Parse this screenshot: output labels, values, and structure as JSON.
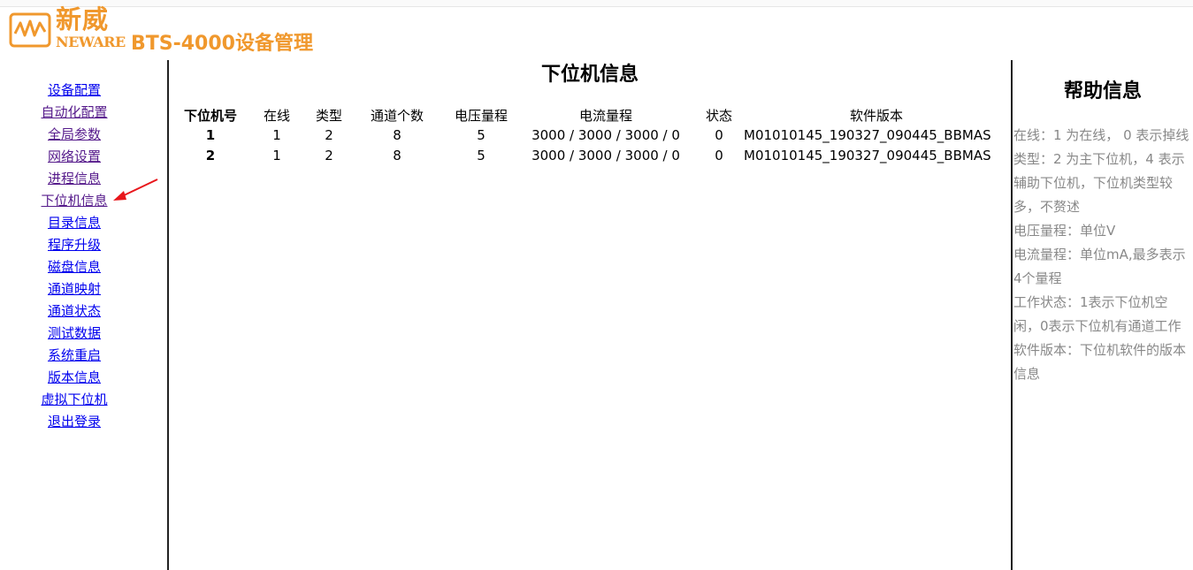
{
  "header": {
    "logo_cn": "新威",
    "logo_en": "NEWARE",
    "app_title": "BTS-4000设备管理"
  },
  "sidebar": {
    "items": [
      {
        "label": "设备配置",
        "visited": false
      },
      {
        "label": "自动化配置",
        "visited": true
      },
      {
        "label": "全局参数",
        "visited": true
      },
      {
        "label": "网络设置",
        "visited": true
      },
      {
        "label": "进程信息",
        "visited": true
      },
      {
        "label": "下位机信息",
        "visited": true
      },
      {
        "label": "目录信息",
        "visited": false
      },
      {
        "label": "程序升级",
        "visited": false
      },
      {
        "label": "磁盘信息",
        "visited": false
      },
      {
        "label": "通道映射",
        "visited": false
      },
      {
        "label": "通道状态",
        "visited": false
      },
      {
        "label": "测试数据",
        "visited": false
      },
      {
        "label": "系统重启",
        "visited": false
      },
      {
        "label": "版本信息",
        "visited": false
      },
      {
        "label": "虚拟下位机",
        "visited": false
      },
      {
        "label": "退出登录",
        "visited": false
      }
    ]
  },
  "main": {
    "title": "下位机信息",
    "table": {
      "headers": [
        "下位机号",
        "在线",
        "类型",
        "通道个数",
        "电压量程",
        "电流量程",
        "状态",
        "软件版本"
      ],
      "rows": [
        [
          "1",
          "1",
          "2",
          "8",
          "5",
          "3000 / 3000 / 3000 / 0",
          "0",
          "M01010145_190327_090445_BBMAS"
        ],
        [
          "2",
          "1",
          "2",
          "8",
          "5",
          "3000 / 3000 / 3000 / 0",
          "0",
          "M01010145_190327_090445_BBMAS"
        ]
      ]
    }
  },
  "help": {
    "title": "帮助信息",
    "lines": [
      "在线：1 为在线， 0 表示掉线",
      "类型：2 为主下位机，4 表示辅助下位机，下位机类型较多，不赘述",
      "电压量程：单位V",
      "电流量程：单位mA,最多表示4个量程",
      "工作状态：1表示下位机空闲，0表示下位机有通道工作",
      "软件版本：下位机软件的版本信息"
    ]
  },
  "colors": {
    "brand": "#f0982d",
    "link": "#0000ee",
    "visited_link": "#551a8b",
    "help_text": "#888888",
    "annotation_arrow": "#e8161b"
  }
}
